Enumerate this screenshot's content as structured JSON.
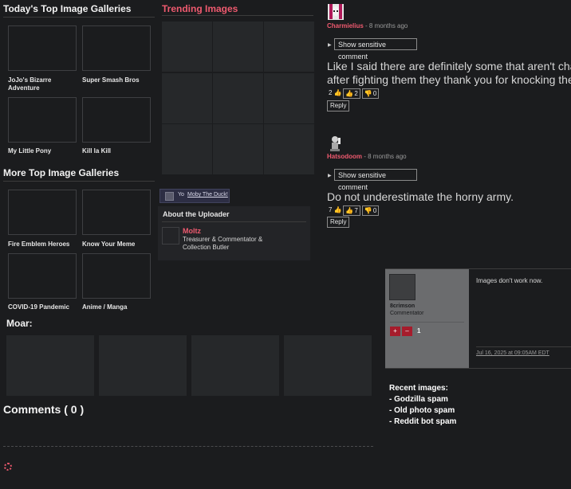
{
  "top_galleries": {
    "title": "Today's Top Image Galleries",
    "items": [
      {
        "label": "JoJo's Bizarre Adventure"
      },
      {
        "label": "Super Smash Bros"
      },
      {
        "label": "My Little Pony"
      },
      {
        "label": "Kill la Kill"
      }
    ]
  },
  "more_galleries": {
    "title": "More Top Image Galleries",
    "items": [
      {
        "label": "Fire Emblem Heroes"
      },
      {
        "label": "Know Your Meme"
      },
      {
        "label": "COVID-19 Pandemic"
      },
      {
        "label": "Anime / Manga"
      }
    ]
  },
  "trending": {
    "title": "Trending Images"
  },
  "yo_link": {
    "prefix": "Yo",
    "link": "Moby The Duck!"
  },
  "uploader": {
    "title": "About the Uploader",
    "name": "Moltz",
    "role": "Treasurer & Commentator & Collection Butler"
  },
  "moar": {
    "title": "Moar:"
  },
  "comments_header": {
    "title": "Comments ( 0 )"
  },
  "comments": [
    {
      "user": "Charmielius",
      "ago": " - 8 months ago",
      "sensitive_label": "Show sensitive comment",
      "text_line1": "Like I said there are definitely some that aren't cha",
      "text_line2": "after fighting them they thank you for knocking the",
      "score": "2",
      "likes": "2",
      "dislikes": "0",
      "reply_label": "Reply"
    },
    {
      "user": "Hatsodoom",
      "ago": " - 8 months ago",
      "sensitive_label": "Show sensitive comment",
      "text_line1": "Do not underestimate the horny army.",
      "score": "7",
      "likes": "7",
      "dislikes": "0",
      "reply_label": "Reply"
    }
  ],
  "image_comment": {
    "user": "8crimson",
    "role": "Commentator",
    "plus": "+",
    "minus": "–",
    "score": "1",
    "text": "Images don't work now.",
    "date": "Jul 16, 2025 at 09:05AM EDT"
  },
  "recent_images": {
    "title": "Recent images:",
    "items": [
      "- Godzilla spam",
      "- Old photo spam",
      "- Reddit bot spam"
    ]
  },
  "colors": {
    "accent_red": "#ef5a6f",
    "panel_gray": "#6b6c6e",
    "vote_red": "#a61c2c"
  }
}
